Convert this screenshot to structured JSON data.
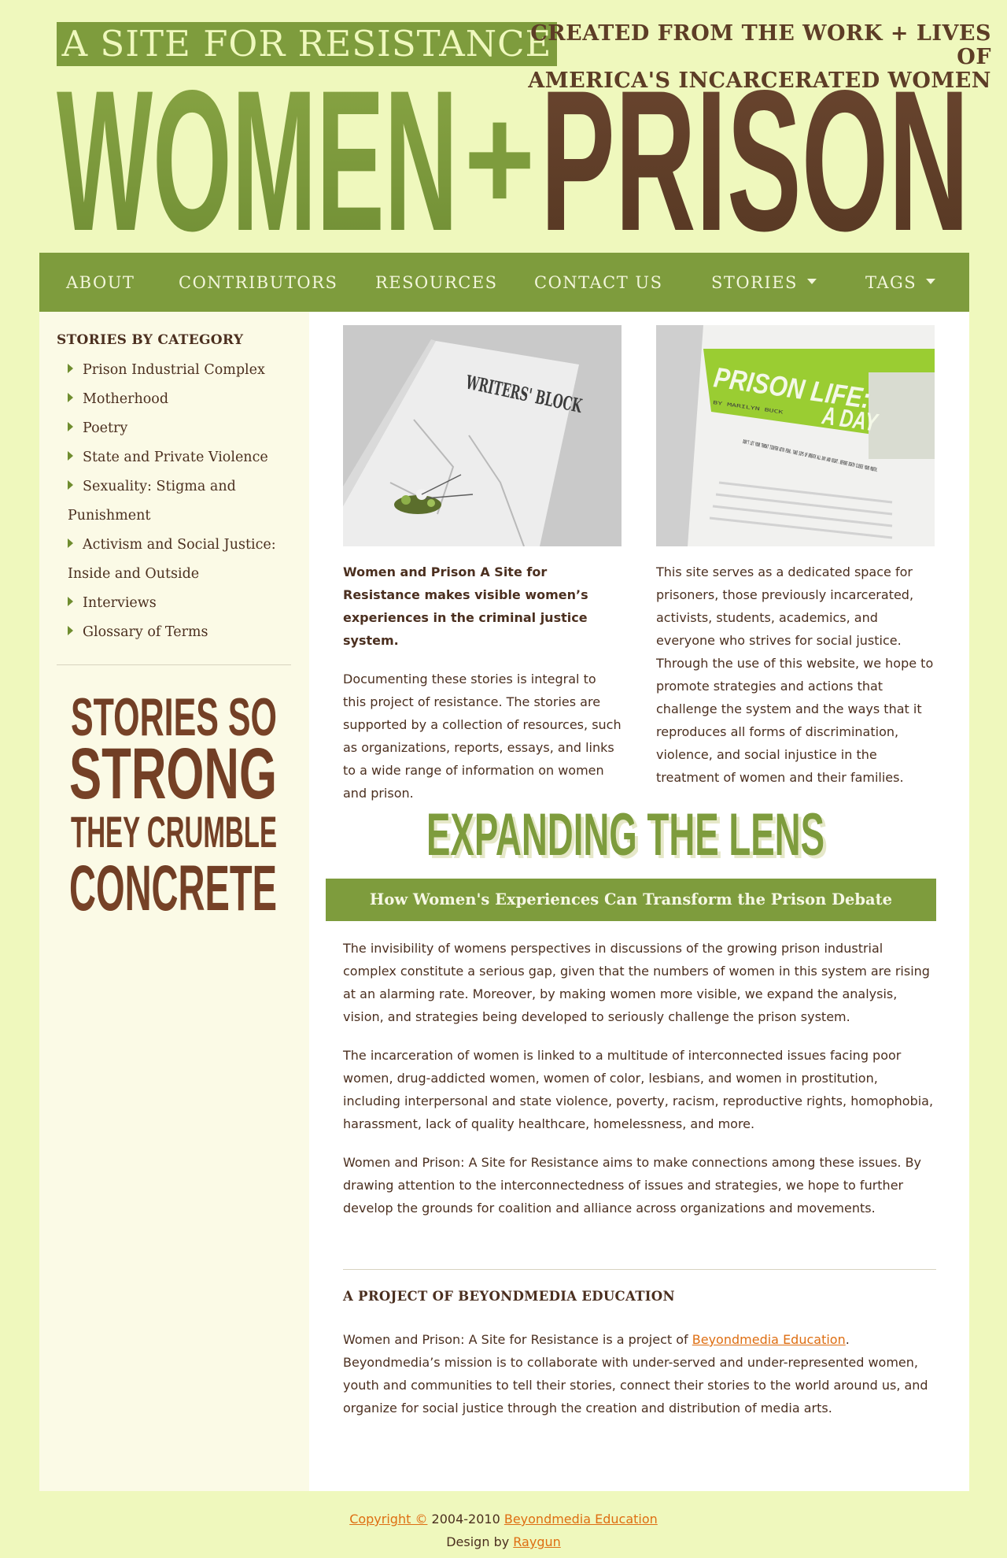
{
  "masthead": {
    "tagline": "A SITE FOR RESISTANCE",
    "created_line1": "CREATED FROM THE WORK + LIVES OF",
    "created_line2": "AMERICA'S INCARCERATED WOMEN",
    "wordmark_women": "WOMEN",
    "wordmark_plus": "+",
    "wordmark_prison": "PRISON"
  },
  "nav": {
    "items": [
      {
        "label": "ABOUT"
      },
      {
        "label": "CONTRIBUTORS"
      },
      {
        "label": "RESOURCES"
      },
      {
        "label": "CONTACT US"
      },
      {
        "label": "STORIES",
        "dropdown": true
      },
      {
        "label": "TAGS",
        "dropdown": true
      }
    ]
  },
  "sidebar": {
    "heading": "STORIES BY CATEGORY",
    "categories": [
      "Prison Industrial Complex",
      "Motherhood",
      "Poetry",
      "State and Private Violence",
      "Sexuality: Stigma and Punishment",
      "Activism and Social Justice: Inside and Outside",
      "Interviews",
      "Glossary of Terms"
    ],
    "slogan": {
      "line1": "STORIES SO",
      "line2": "STRONG",
      "line3": "THEY CRUMBLE",
      "line4": "CONCRETE"
    }
  },
  "main": {
    "thumb_left": {
      "title": "WRITERS' BLOCK"
    },
    "thumb_right": {
      "title_line1": "PRISON LIFE:",
      "title_line2": "A DAY",
      "byline": "BY MARILYN BUCK",
      "quote": "DON'T LET YOUR THROAT TIGHTEN WITH FEAR. TAKE SIPS OF BREATH ALL DAY AND NIGHT. BEFORE DEATH CLOSES YOUR MOUTH."
    },
    "intro_bold": "Women and Prison A Site for Resistance makes visible women’s experiences in the criminal justice system.",
    "intro_text": "Documenting these stories is integral to this project of resistance. The stories are supported by a collection of resources, such as organizations, reports, essays, and links to a wide range of information on women and prison.",
    "purpose_text": "This site serves as a dedicated space for prisoners, those previously incarcerated, activists, students, academics, and everyone who strives for social justice. Through the use of this website, we hope to promote strategies and actions that challenge the system and the ways that it reproduces all forms of discrimination, violence, and social injustice in the treatment of women and their families.",
    "lens_title": "EXPANDING THE LENS",
    "lens_subtitle": "How Women's Experiences Can Transform the Prison Debate",
    "paragraphs": [
      "The invisibility of womens perspectives in discussions of the growing prison industrial complex constitute a serious gap, given that the numbers of women in this system are rising at an alarming rate. Moreover, by making women more visible, we expand the analysis, vision, and strategies being developed to seriously challenge the prison system.",
      "The incarceration of women is linked to a multitude of interconnected issues facing poor women, drug-addicted women, women of color, lesbians, and women in prostitution, including interpersonal and state violence, poverty, racism, reproductive rights, homophobia, harassment, lack of quality healthcare, homelessness, and more.",
      "Women and Prison: A Site for Resistance aims to make connections among these issues. By drawing attention to the interconnectedness of issues and strategies, we hope to further develop the grounds for coalition and alliance across organizations and movements."
    ],
    "project_heading": "A PROJECT OF BEYONDMEDIA EDUCATION",
    "project_before": "Women and Prison: A Site for Resistance is a project of ",
    "project_link": "Beyondmedia Education",
    "project_after": ". Beyondmedia’s mission is to collaborate with under-served and under-represented women, youth and communities to tell their stories, connect their stories to the world around us, and organize for social justice through the creation and distribution of media arts."
  },
  "footer": {
    "copyright_link": "Copyright ©",
    "years": " 2004-2010 ",
    "org_link": "Beyondmedia Education",
    "design_by": "Design by ",
    "designer_link": "Raygun"
  },
  "colors": {
    "page_bg": "#eff8bd",
    "accent_green": "#7e9c3d",
    "brown": "#5d3d26",
    "link_orange": "#de6e12"
  }
}
